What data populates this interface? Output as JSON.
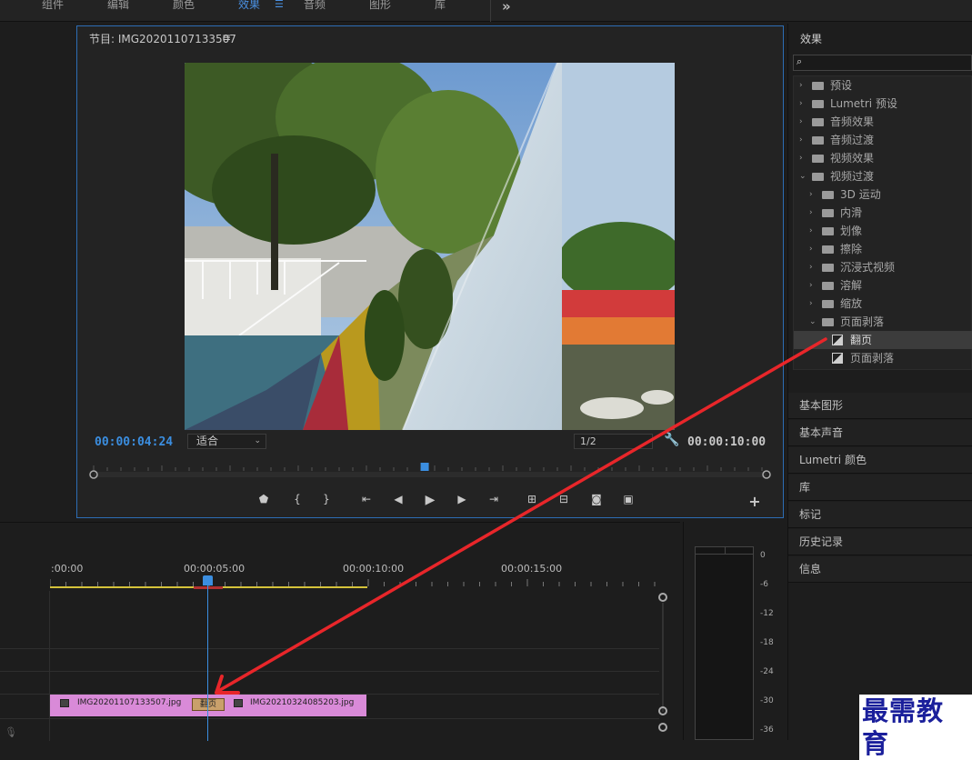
{
  "workspace_tabs": [
    {
      "label": "组件",
      "active": false
    },
    {
      "label": "编辑",
      "active": false
    },
    {
      "label": "颜色",
      "active": false
    },
    {
      "label": "效果",
      "active": true
    },
    {
      "label": "音频",
      "active": false
    },
    {
      "label": "图形",
      "active": false
    },
    {
      "label": "库",
      "active": false
    }
  ],
  "program_monitor": {
    "title": "节目: IMG20201107133507",
    "menu_icon": "≡",
    "current_timecode": "00:00:04:24",
    "fit_select": "适合",
    "resolution_select": "1/2",
    "duration_timecode": "00:00:10:00",
    "playhead_fraction": 0.492
  },
  "effects_panel": {
    "title": "效果",
    "search_placeholder": "",
    "tree": [
      {
        "label": "预设",
        "level": 0,
        "expanded": false,
        "kind": "preset-folder"
      },
      {
        "label": "Lumetri 预设",
        "level": 0,
        "expanded": false,
        "kind": "preset-folder"
      },
      {
        "label": "音频效果",
        "level": 0,
        "expanded": false,
        "kind": "folder"
      },
      {
        "label": "音频过渡",
        "level": 0,
        "expanded": false,
        "kind": "folder"
      },
      {
        "label": "视频效果",
        "level": 0,
        "expanded": false,
        "kind": "folder"
      },
      {
        "label": "视频过渡",
        "level": 0,
        "expanded": true,
        "kind": "folder"
      },
      {
        "label": "3D 运动",
        "level": 1,
        "expanded": false,
        "kind": "folder"
      },
      {
        "label": "内滑",
        "level": 1,
        "expanded": false,
        "kind": "folder"
      },
      {
        "label": "划像",
        "level": 1,
        "expanded": false,
        "kind": "folder"
      },
      {
        "label": "擦除",
        "level": 1,
        "expanded": false,
        "kind": "folder"
      },
      {
        "label": "沉浸式视频",
        "level": 1,
        "expanded": false,
        "kind": "folder"
      },
      {
        "label": "溶解",
        "level": 1,
        "expanded": false,
        "kind": "folder"
      },
      {
        "label": "缩放",
        "level": 1,
        "expanded": false,
        "kind": "folder"
      },
      {
        "label": "页面剥落",
        "level": 1,
        "expanded": true,
        "kind": "folder"
      },
      {
        "label": "翻页",
        "level": 2,
        "kind": "effect",
        "selected": true
      },
      {
        "label": "页面剥落",
        "level": 2,
        "kind": "effect",
        "selected": false
      }
    ],
    "side_panels": [
      "基本图形",
      "基本声音",
      "Lumetri 颜色",
      "库",
      "标记",
      "历史记录",
      "信息"
    ]
  },
  "timeline": {
    "ruler_labels": [
      ":00:00",
      "00:00:05:00",
      "00:00:10:00",
      "00:00:15:00"
    ],
    "clips": [
      {
        "name": "IMG20201107133507.jpg"
      },
      {
        "name": "IMG20210324085203.jpg"
      }
    ],
    "transition_label": "翻页"
  },
  "audio_meter": {
    "db_labels": [
      "0",
      "-6",
      "-12",
      "-18",
      "-24",
      "-30",
      "-36"
    ]
  },
  "watermark": "最需教育",
  "colors": {
    "accent_blue": "#3b8ee0",
    "clip_pink": "#d98ad8",
    "workarea_yellow": "#d4c23a",
    "annotation_red": "#e8262a"
  }
}
